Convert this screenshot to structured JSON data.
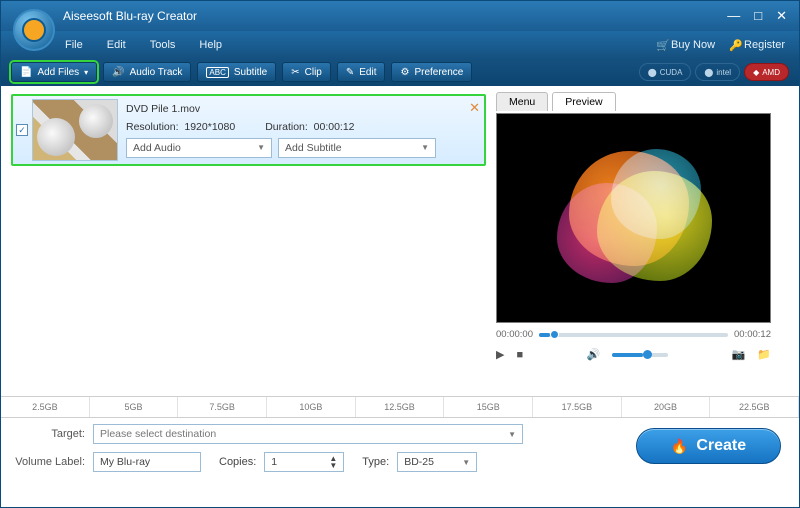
{
  "title": "Aiseesoft Blu-ray Creator",
  "menu": {
    "file": "File",
    "edit": "Edit",
    "tools": "Tools",
    "help": "Help",
    "buynow": "Buy Now",
    "register": "Register"
  },
  "toolbar": {
    "addfiles": "Add Files",
    "audiotrack": "Audio Track",
    "subtitle": "Subtitle",
    "clip": "Clip",
    "edit": "Edit",
    "preference": "Preference"
  },
  "chips": {
    "cuda": "CUDA",
    "intel": "intel",
    "amd": "AMD"
  },
  "file": {
    "name": "DVD Pile 1.mov",
    "res_label": "Resolution:",
    "res_val": "1920*1080",
    "dur_label": "Duration:",
    "dur_val": "00:00:12",
    "add_audio": "Add Audio",
    "add_sub": "Add Subtitle"
  },
  "tabs": {
    "menu": "Menu",
    "preview": "Preview"
  },
  "time": {
    "start": "00:00:00",
    "end": "00:00:12"
  },
  "ruler": [
    "2.5GB",
    "5GB",
    "7.5GB",
    "10GB",
    "12.5GB",
    "15GB",
    "17.5GB",
    "20GB",
    "22.5GB"
  ],
  "bottom": {
    "target": "Target:",
    "target_ph": "Please select destination",
    "vlabel": "Volume Label:",
    "vval": "My Blu-ray",
    "copies": "Copies:",
    "copies_val": "1",
    "type": "Type:",
    "type_val": "BD-25",
    "create": "Create"
  }
}
